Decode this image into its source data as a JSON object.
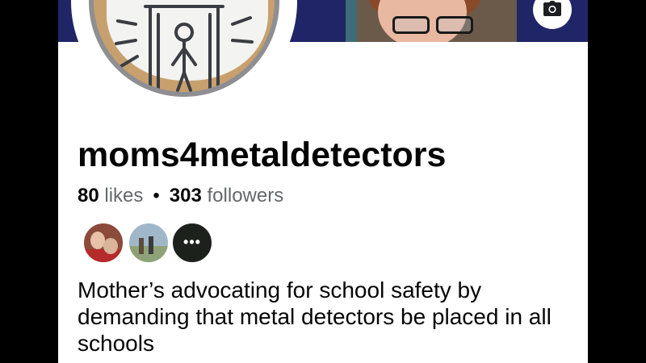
{
  "profile": {
    "name": "moms4metaldetectors",
    "likes_count": "80",
    "likes_label": "likes",
    "separator": "•",
    "followers_count": "303",
    "followers_label": "followers",
    "bio": "Mother’s advocating for school safety by demanding that metal detectors be placed in all schools"
  },
  "friends_more": "•••",
  "icons": {
    "avatar_camera": "camera-icon",
    "cover_camera": "camera-icon"
  },
  "colors": {
    "cover_bg": "#1f2566",
    "text_primary": "#050505",
    "text_secondary": "#65676b",
    "avatar_ring": "#8e8e93"
  }
}
